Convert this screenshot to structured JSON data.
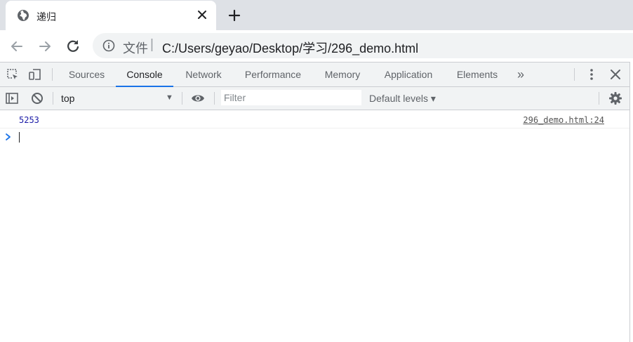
{
  "browser": {
    "tab": {
      "title": "递归"
    },
    "address": {
      "scheme_label": "文件",
      "separator": "|",
      "url": "C:/Users/geyao/Desktop/学习/296_demo.html"
    }
  },
  "devtools": {
    "tabs": [
      "Sources",
      "Console",
      "Network",
      "Performance",
      "Memory",
      "Application",
      "Elements"
    ],
    "active_tab": "Console",
    "overflow_label": "»",
    "console_toolbar": {
      "context": "top",
      "filter_placeholder": "Filter",
      "levels": "Default levels ▾"
    },
    "messages": [
      {
        "value": "5253",
        "source": "296_demo.html:24"
      }
    ]
  },
  "colors": {
    "accent": "#1a73e8",
    "log_value": "#1a1aa6",
    "chrome_bg": "#dee1e6"
  }
}
